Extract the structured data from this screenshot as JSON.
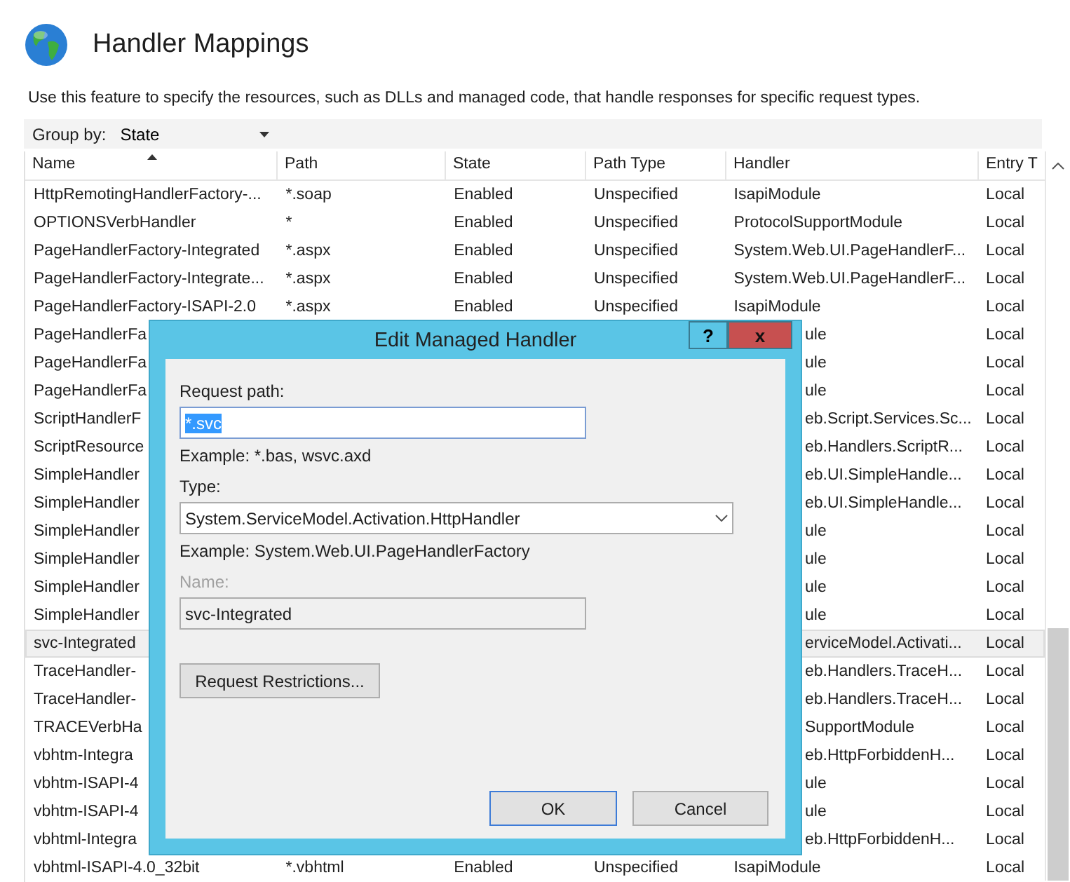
{
  "page": {
    "title": "Handler Mappings",
    "description": "Use this feature to specify the resources, such as DLLs and managed code, that handle responses for specific request types."
  },
  "group_by": {
    "label": "Group by:",
    "value": "State"
  },
  "table": {
    "columns": [
      {
        "label": "Name",
        "sorted": true
      },
      {
        "label": "Path",
        "sorted": false
      },
      {
        "label": "State",
        "sorted": false
      },
      {
        "label": "Path Type",
        "sorted": false
      },
      {
        "label": "Handler",
        "sorted": false
      },
      {
        "label": "Entry T",
        "sorted": false
      }
    ],
    "rows": [
      {
        "kind": "full",
        "selected": false,
        "cells": [
          "HttpRemotingHandlerFactory-...",
          "*.soap",
          "Enabled",
          "Unspecified",
          "IsapiModule",
          "Local"
        ]
      },
      {
        "kind": "full",
        "selected": false,
        "cells": [
          "OPTIONSVerbHandler",
          "*",
          "Enabled",
          "Unspecified",
          "ProtocolSupportModule",
          "Local"
        ]
      },
      {
        "kind": "full",
        "selected": false,
        "cells": [
          "PageHandlerFactory-Integrated",
          "*.aspx",
          "Enabled",
          "Unspecified",
          "System.Web.UI.PageHandlerF...",
          "Local"
        ]
      },
      {
        "kind": "full",
        "selected": false,
        "cells": [
          "PageHandlerFactory-Integrate...",
          "*.aspx",
          "Enabled",
          "Unspecified",
          "System.Web.UI.PageHandlerF...",
          "Local"
        ]
      },
      {
        "kind": "full",
        "selected": false,
        "cells": [
          "PageHandlerFactory-ISAPI-2.0",
          "*.aspx",
          "Enabled",
          "Unspecified",
          "IsapiModule",
          "Local"
        ]
      },
      {
        "kind": "covered",
        "selected": false,
        "name": "PageHandlerFa",
        "handler": "ule",
        "entry_type": "Local"
      },
      {
        "kind": "covered",
        "selected": false,
        "name": "PageHandlerFa",
        "handler": "ule",
        "entry_type": "Local"
      },
      {
        "kind": "covered",
        "selected": false,
        "name": "PageHandlerFa",
        "handler": "ule",
        "entry_type": "Local"
      },
      {
        "kind": "covered",
        "selected": false,
        "name": "ScriptHandlerF",
        "handler": "eb.Script.Services.Sc...",
        "entry_type": "Local"
      },
      {
        "kind": "covered",
        "selected": false,
        "name": "ScriptResource",
        "handler": "eb.Handlers.ScriptR...",
        "entry_type": "Local"
      },
      {
        "kind": "covered",
        "selected": false,
        "name": "SimpleHandler",
        "handler": "eb.UI.SimpleHandle...",
        "entry_type": "Local"
      },
      {
        "kind": "covered",
        "selected": false,
        "name": "SimpleHandler",
        "handler": "eb.UI.SimpleHandle...",
        "entry_type": "Local"
      },
      {
        "kind": "covered",
        "selected": false,
        "name": "SimpleHandler",
        "handler": "ule",
        "entry_type": "Local"
      },
      {
        "kind": "covered",
        "selected": false,
        "name": "SimpleHandler",
        "handler": "ule",
        "entry_type": "Local"
      },
      {
        "kind": "covered",
        "selected": false,
        "name": "SimpleHandler",
        "handler": "ule",
        "entry_type": "Local"
      },
      {
        "kind": "covered",
        "selected": false,
        "name": "SimpleHandler",
        "handler": "ule",
        "entry_type": "Local"
      },
      {
        "kind": "covered",
        "selected": true,
        "name": "svc-Integrated",
        "handler": "erviceModel.Activati...",
        "entry_type": "Local"
      },
      {
        "kind": "covered",
        "selected": false,
        "name": "TraceHandler-",
        "handler": "eb.Handlers.TraceH...",
        "entry_type": "Local"
      },
      {
        "kind": "covered",
        "selected": false,
        "name": "TraceHandler-",
        "handler": "eb.Handlers.TraceH...",
        "entry_type": "Local"
      },
      {
        "kind": "covered",
        "selected": false,
        "name": "TRACEVerbHa",
        "handler": "SupportModule",
        "entry_type": "Local"
      },
      {
        "kind": "covered",
        "selected": false,
        "name": "vbhtm-Integra",
        "handler": "eb.HttpForbiddenH...",
        "entry_type": "Local"
      },
      {
        "kind": "covered",
        "selected": false,
        "name": "vbhtm-ISAPI-4",
        "handler": "ule",
        "entry_type": "Local"
      },
      {
        "kind": "covered",
        "selected": false,
        "name": "vbhtm-ISAPI-4",
        "handler": "ule",
        "entry_type": "Local"
      },
      {
        "kind": "covered",
        "selected": false,
        "name": "vbhtml-Integra",
        "handler": "eb.HttpForbiddenH...",
        "entry_type": "Local"
      },
      {
        "kind": "full",
        "selected": false,
        "cells": [
          "vbhtml-ISAPI-4.0_32bit",
          "*.vbhtml",
          "Enabled",
          "Unspecified",
          "IsapiModule",
          "Local"
        ]
      }
    ]
  },
  "dialog": {
    "title": "Edit Managed Handler",
    "help_button": "?",
    "close_button": "x",
    "request_path": {
      "label": "Request path:",
      "value": "*.svc",
      "text_selected": true,
      "example": "Example: *.bas, wsvc.axd"
    },
    "type": {
      "label": "Type:",
      "value": "System.ServiceModel.Activation.HttpHandler",
      "example": "Example: System.Web.UI.PageHandlerFactory"
    },
    "name": {
      "label": "Name:",
      "value": "svc-Integrated",
      "disabled": true
    },
    "restrictions_button": "Request Restrictions...",
    "buttons": [
      {
        "label": "OK",
        "default": true
      },
      {
        "label": "Cancel",
        "default": false
      }
    ]
  }
}
